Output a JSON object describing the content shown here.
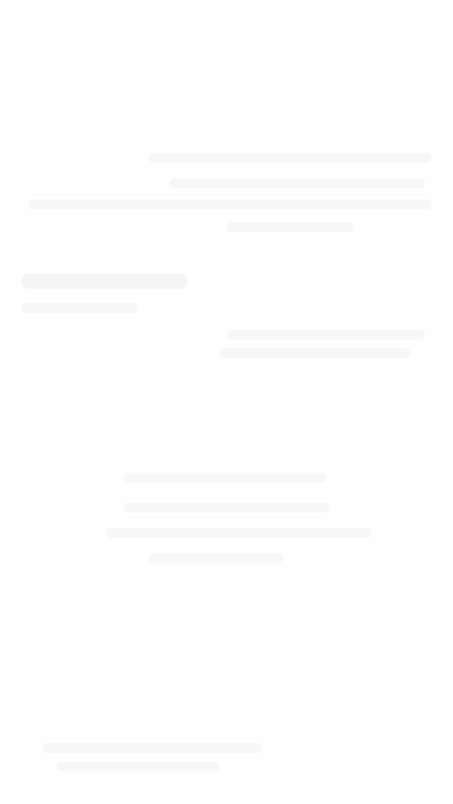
{
  "screen": {
    "background_color": "#fefefe",
    "placeholder_color": "#f7f7f7",
    "state": "blank"
  }
}
